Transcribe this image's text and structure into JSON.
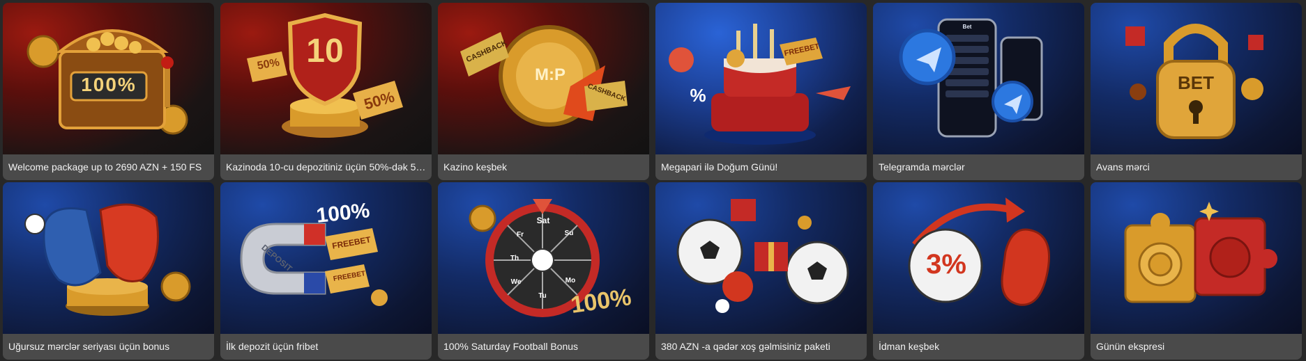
{
  "promotions": [
    {
      "title": "Welcome package up to 2690 AZN + 150 FS",
      "art_text": "100%"
    },
    {
      "title": "Kazinoda 10-cu depozitiniz üçün 50%-dək 59...",
      "art_text": "10",
      "art_text2": "50%",
      "art_text3": "50%"
    },
    {
      "title": "Kazino keşbek",
      "art_text": "M:P",
      "art_text2": "CASHBACK",
      "art_text3": "CASHBACK"
    },
    {
      "title": "Megapari ilə Doğum Günü!",
      "art_text": "FREEBET",
      "art_text2": "%"
    },
    {
      "title": "Telegramda mərclər",
      "art_text": "Bet"
    },
    {
      "title": "Avans mərci",
      "art_text": "BET"
    },
    {
      "title": "Uğursuz mərclər seriyası üçün bonus"
    },
    {
      "title": "İlk depozit üçün fribet",
      "art_text": "100%",
      "art_text2": "FREEBET",
      "art_text3": "FREEBET",
      "art_text4": "DEPOSIT"
    },
    {
      "title": "100% Saturday Football Bonus",
      "art_text": "100%",
      "art_text2": "Sat",
      "art_text3": "Su",
      "art_text4": "Mo",
      "art_text5": "Tu",
      "art_text6": "We",
      "art_text7": "Th",
      "art_text8": "Fr"
    },
    {
      "title": "380 AZN -a qədər xoş gəlmisiniz paketi"
    },
    {
      "title": "İdman keşbek",
      "art_text": "3%"
    },
    {
      "title": "Günün ekspresi"
    }
  ],
  "colors": {
    "page_bg": "#282828",
    "caption_bg": "#4a4a4a",
    "caption_text": "#f2f2f2",
    "gold": "#e0a53a",
    "red": "#d2361f",
    "blue": "#2c78e0"
  }
}
